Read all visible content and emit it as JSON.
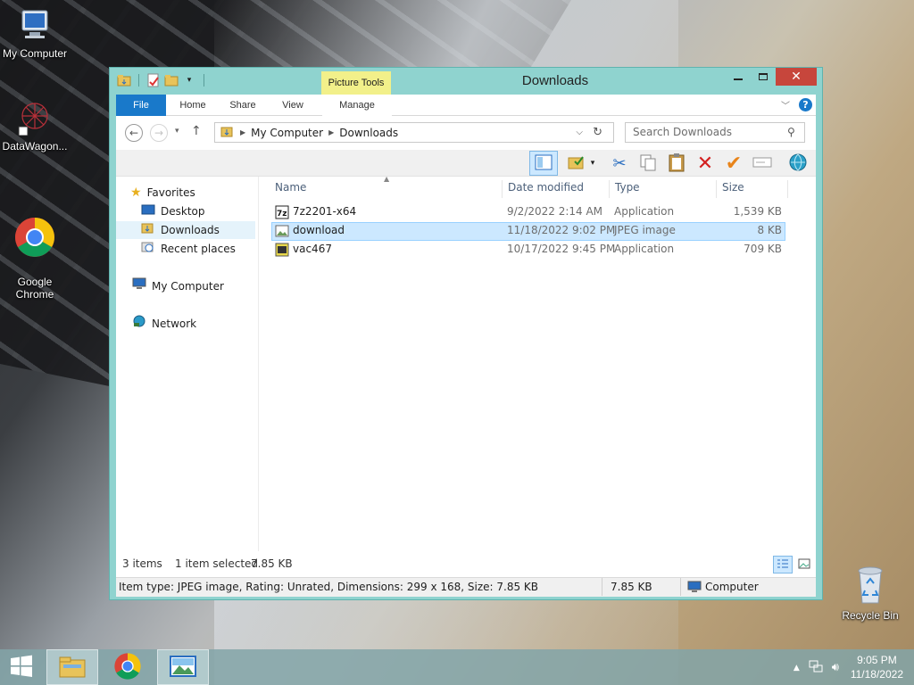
{
  "desktop": {
    "icons": [
      {
        "label": "My Computer"
      },
      {
        "label": "DataWagon..."
      },
      {
        "label": "Google\nChrome"
      },
      {
        "label": "Recycle Bin"
      }
    ]
  },
  "window": {
    "title": "Downloads",
    "context_tab": "Picture Tools",
    "ribbon_tabs": [
      "File",
      "Home",
      "Share",
      "View",
      "Manage"
    ],
    "breadcrumb": [
      "My Computer",
      "Downloads"
    ],
    "search_placeholder": "Search Downloads",
    "nav": {
      "favorites": "Favorites",
      "favorites_items": [
        "Desktop",
        "Downloads",
        "Recent places"
      ],
      "computer": "My Computer",
      "network": "Network"
    },
    "columns": [
      "Name",
      "Date modified",
      "Type",
      "Size"
    ],
    "files": [
      {
        "name": "7z2201-x64",
        "date": "9/2/2022 2:14 AM",
        "type": "Application",
        "size": "1,539 KB",
        "icon": "7z-app-icon"
      },
      {
        "name": "download",
        "date": "11/18/2022 9:02 PM",
        "type": "JPEG image",
        "size": "8 KB",
        "icon": "image-file-icon",
        "selected": true
      },
      {
        "name": "vac467",
        "date": "10/17/2022 9:45 PM",
        "type": "Application",
        "size": "709 KB",
        "icon": "app-icon"
      }
    ],
    "status": {
      "items": "3 items",
      "selected": "1 item selected",
      "selected_size": "7.85 KB"
    },
    "details": {
      "info": "Item type: JPEG image, Rating: Unrated, Dimensions: 299 x 168, Size: 7.85 KB",
      "size": "7.85 KB",
      "location": "Computer"
    }
  },
  "taskbar": {
    "time": "9:05 PM",
    "date": "11/18/2022"
  }
}
